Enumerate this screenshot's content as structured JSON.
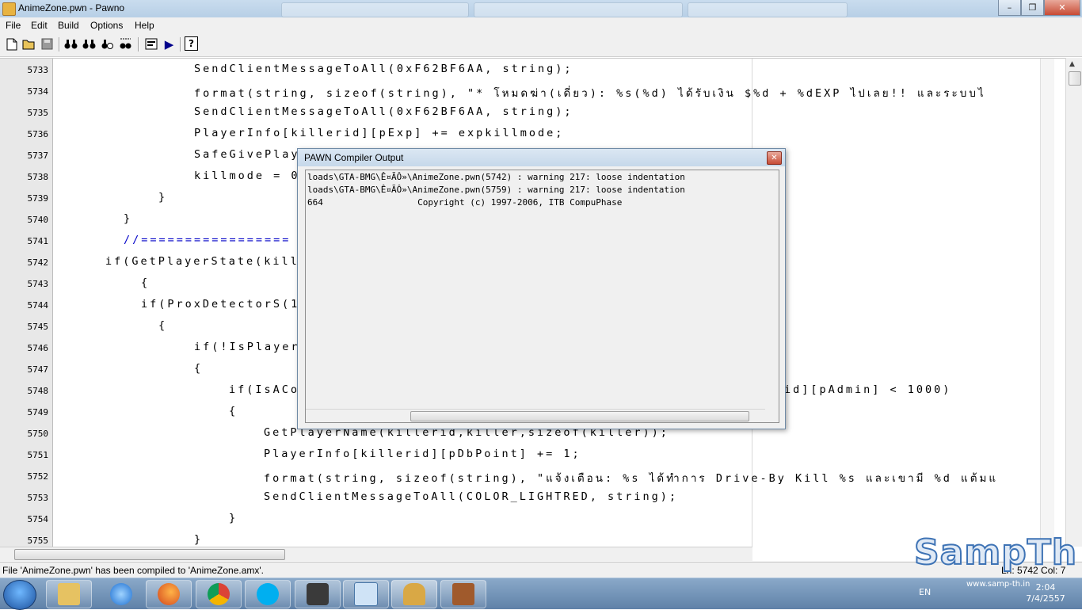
{
  "window": {
    "title": "AnimeZone.pwn - Pawno",
    "min": "–",
    "max": "❐",
    "close": "✕"
  },
  "menu": [
    "File",
    "Edit",
    "Build",
    "Options",
    "Help"
  ],
  "toolbar": {
    "new": "new-file",
    "open": "open-folder",
    "save": "save-disk",
    "find": "binoculars",
    "find_next": "find-next",
    "replace": "replace",
    "goto": "goto",
    "functions": "function-list",
    "compile": "▶",
    "help": "?"
  },
  "editor": {
    "lines": [
      {
        "num": "5733",
        "text": "SendClientMessageToAll(0xF62BF6AA, string);"
      },
      {
        "num": "5734",
        "text": "format(string, sizeof(string), \"* โหมดฆ่า(เดี่ยว): %s(%d) ได้รับเงิน $%d + %dEXP ไปเลย!! และระบบไ"
      },
      {
        "num": "5735",
        "text": "SendClientMessageToAll(0xF62BF6AA, string);"
      },
      {
        "num": "5736",
        "text": "PlayerInfo[killerid][pExp] += expkillmode;"
      },
      {
        "num": "5737",
        "text": "SafeGivePlay"
      },
      {
        "num": "5738",
        "text": "killmode = 0"
      },
      {
        "num": "5739",
        "text": "}"
      },
      {
        "num": "5740",
        "text": "}"
      },
      {
        "num": "5741",
        "text": "//================="
      },
      {
        "num": "5742",
        "text": "if(GetPlayerState(kill"
      },
      {
        "num": "5743",
        "text": "{"
      },
      {
        "num": "5744",
        "text": "if(ProxDetectorS(1"
      },
      {
        "num": "5745",
        "text": "{"
      },
      {
        "num": "5746",
        "text": "if(!IsPlayer"
      },
      {
        "num": "5747",
        "text": "{"
      },
      {
        "num": "5748",
        "text": "if(IsACo"
      },
      {
        "num": "5749",
        "text": "{"
      },
      {
        "num": "5750",
        "text": "GetPlayerName(killerid,killer,sizeof(killer));"
      },
      {
        "num": "5751",
        "text": "PlayerInfo[killerid][pDbPoint] += 1;"
      },
      {
        "num": "5752",
        "text": "format(string, sizeof(string), \"แจ้งเตือน: %s ได้ทำการ Drive-By Kill %s และเขามี %d แต้มแ"
      },
      {
        "num": "5753",
        "text": "SendClientMessageToAll(COLOR_LIGHTRED, string);"
      },
      {
        "num": "5754",
        "text": "}"
      },
      {
        "num": "5755",
        "text": "}"
      }
    ],
    "line_5748_tail": "id][pAdmin] < 1000)"
  },
  "dialog": {
    "title": "PAWN Compiler Output",
    "close": "✕",
    "output": [
      "loads\\GTA-BMG\\Ê¤ÃÔ»\\AnimeZone.pwn(5742) : warning 217: loose indentation",
      "loads\\GTA-BMG\\Ê¤ÃÔ»\\AnimeZone.pwn(5759) : warning 217: loose indentation",
      "664                  Copyright (c) 1997-2006, ITB CompuPhase"
    ]
  },
  "status": {
    "message": "File 'AnimeZone.pwn' has been compiled to 'AnimeZone.amx'.",
    "position": "Ln: 5742  Col: 7"
  },
  "taskbar": {
    "apps": [
      "explorer",
      "internet-explorer",
      "firefox",
      "chrome",
      "skype",
      "app-s",
      "control-panel",
      "pawno",
      "books"
    ],
    "language": "EN",
    "time": "2:04",
    "date": "7/4/2557"
  },
  "watermark": {
    "brand": "SampTh",
    "url": "www.samp-th.in"
  },
  "colors": {
    "keyword": "#0000c8",
    "titlebar": "#c6d8ea",
    "taskbar": "#6f90b6"
  }
}
